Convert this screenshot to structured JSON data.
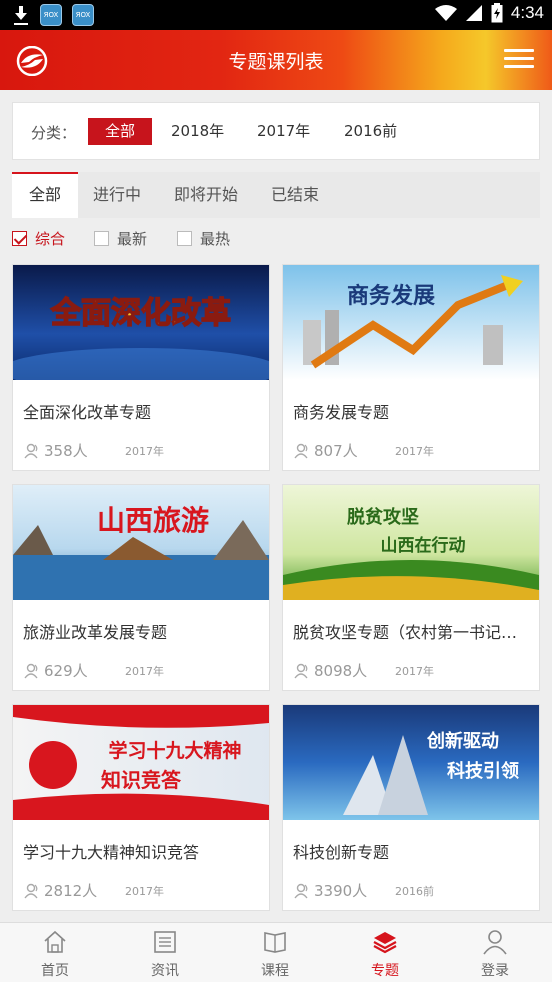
{
  "status_bar": {
    "time": "4:34",
    "notifications": [
      "download-icon",
      "app-icon",
      "app-icon"
    ],
    "app_icon_text": "ЯOX"
  },
  "header": {
    "title": "专题课列表",
    "logo": "party-school-logo",
    "menu_icon": "hamburger-menu-icon"
  },
  "category_filter": {
    "label": "分类：",
    "options": [
      "全部",
      "2018年",
      "2017年",
      "2016前"
    ],
    "selected": "全部"
  },
  "status_tabs": {
    "tabs": [
      "全部",
      "进行中",
      "即将开始",
      "已结束"
    ],
    "selected": "全部"
  },
  "sort_options": {
    "options": [
      {
        "label": "综合",
        "checked": true
      },
      {
        "label": "最新",
        "checked": false
      },
      {
        "label": "最热",
        "checked": false
      }
    ]
  },
  "courses": [
    {
      "title": "全面深化改革专题",
      "participants": "358人",
      "year": "2017年",
      "banner_text": "全面深化改革"
    },
    {
      "title": "商务发展专题",
      "participants": "807人",
      "year": "2017年",
      "banner_text": "商务发展"
    },
    {
      "title": "旅游业改革发展专题",
      "participants": "629人",
      "year": "2017年",
      "banner_text": "山西旅游"
    },
    {
      "title": "脱贫攻坚专题（农村第一书记培训）",
      "participants": "8098人",
      "year": "2017年",
      "banner_text": "脱贫攻坚",
      "banner_text2": "山西在行动"
    },
    {
      "title": "学习十九大精神知识竞答",
      "participants": "2812人",
      "year": "2017年",
      "banner_text": "学习十九大精神",
      "banner_text2": "知识竞答"
    },
    {
      "title": "科技创新专题",
      "participants": "3390人",
      "year": "2016前",
      "banner_text": "创新驱动",
      "banner_text2": "科技引领"
    }
  ],
  "bottom_nav": {
    "items": [
      {
        "label": "首页",
        "icon": "home-icon"
      },
      {
        "label": "资讯",
        "icon": "news-icon"
      },
      {
        "label": "课程",
        "icon": "book-icon"
      },
      {
        "label": "专题",
        "icon": "layers-icon"
      },
      {
        "label": "登录",
        "icon": "user-icon"
      }
    ],
    "selected": "专题"
  },
  "colors": {
    "accent": "#c7141c",
    "header_start": "#d8170e",
    "header_end": "#f5c82a"
  }
}
